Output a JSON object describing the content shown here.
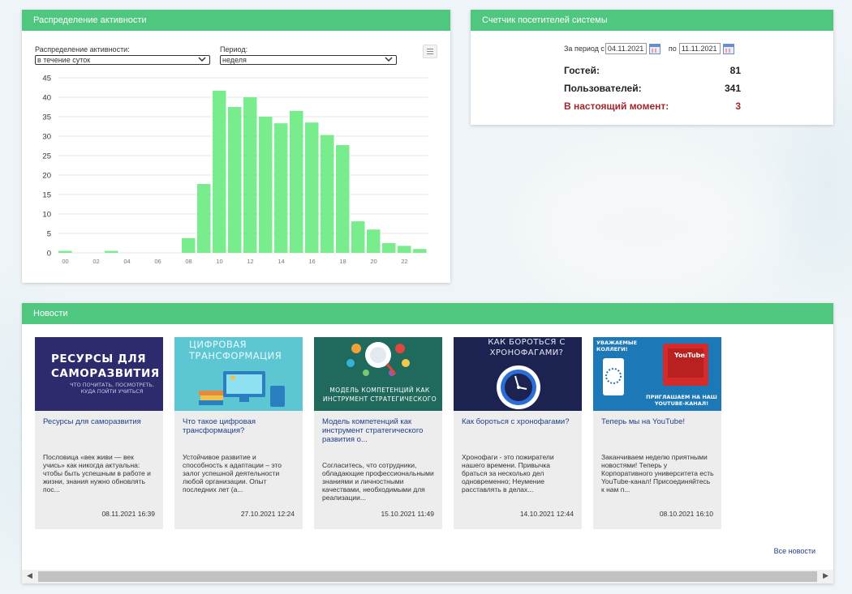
{
  "activity": {
    "title": "Распределение активности",
    "distribution_label": "Распределение активности:",
    "distribution_value": "в течение суток",
    "period_label": "Период:",
    "period_value": "неделя"
  },
  "chart_data": {
    "type": "bar",
    "title": "",
    "xlabel": "",
    "ylabel": "",
    "ylim": [
      0,
      45
    ],
    "y_ticks": [
      0,
      5,
      10,
      15,
      20,
      25,
      30,
      35,
      40,
      45
    ],
    "x_tick_labels": [
      "00",
      "02",
      "04",
      "06",
      "08",
      "10",
      "12",
      "14",
      "16",
      "18",
      "20",
      "22"
    ],
    "categories": [
      "00",
      "01",
      "02",
      "03",
      "04",
      "05",
      "06",
      "07",
      "08",
      "09",
      "10",
      "11",
      "12",
      "13",
      "14",
      "15",
      "16",
      "17",
      "18",
      "19",
      "20",
      "21",
      "22",
      "23"
    ],
    "values": [
      0.5,
      0,
      0,
      0.5,
      0,
      0,
      0,
      0,
      3.8,
      17.7,
      41.7,
      37.5,
      40,
      35,
      33.3,
      36.5,
      33.5,
      30.3,
      27.7,
      8.1,
      6,
      2.5,
      1.8,
      1
    ],
    "bar_color": "#79ec8d",
    "grid": true
  },
  "visitors": {
    "title": "Счетчик посетителей системы",
    "period_from_label": "За период с",
    "date_from": "04.11.2021",
    "period_to_label": "по",
    "date_to": "11.11.2021",
    "guests_label": "Гостей:",
    "guests_value": "81",
    "users_label": "Пользователей:",
    "users_value": "341",
    "now_label": "В настоящий момент:",
    "now_value": "3"
  },
  "news": {
    "title": "Новости",
    "all_news_label": "Все новости",
    "items": [
      {
        "title": "Ресурсы для саморазвития",
        "text": "Пословица «век живи — век учись» как никогда актуальна: чтобы быть успешным в работе и жизни, знания нужно обновлять пос...",
        "date": "08.11.2021 16:39",
        "image_title": "РЕСУРСЫ ДЛЯ САМОРАЗВИТИЯ",
        "image_subtitle": "ЧТО ПОЧИТАТЬ, ПОСМОТРЕТЬ, КУДА ПОЙТИ УЧИТЬСЯ"
      },
      {
        "title": "Что такое цифровая трансформация?",
        "text": "Устойчивое развитие и способность к адаптации – это залог успешной деятельности любой организации. Опыт последних лет (а...",
        "date": "27.10.2021 12:24",
        "image_title": "ЦИФРОВАЯ ТРАНСФОРМАЦИЯ"
      },
      {
        "title": "Модель компетенций как инструмент стратегического развития о...",
        "text": "Согласитесь, что сотрудники, обладающие профессиональными знаниями и личностными качествами, необходимыми для реализации...",
        "date": "15.10.2021 11:49",
        "image_title": "МОДЕЛЬ КОМПЕТЕНЦИЙ КАК ИНСТРУМЕНТ СТРАТЕГИЧЕСКОГО"
      },
      {
        "title": "Как бороться с хронофагами?",
        "text": "Хронофаги - это пожиратели нашего времени.   Привычка браться за несколько дел одновременно; Неумение расставлять в делах...",
        "date": "14.10.2021 12:44",
        "image_title": "КАК БОРОТЬСЯ С ХРОНОФАГАМИ?"
      },
      {
        "title": "Теперь мы на YouTube!",
        "text": "Заканчиваем неделю приятными новостями! Теперь у Корпоративного университета есть YouTube-канал! Присоединяйтесь к нам п...",
        "date": "08.10.2021 16:10",
        "image_title": "УВАЖАЕМЫЕ КОЛЛЕГИ!",
        "image_subtitle": "ПРИГЛАШАЕМ НА НАШ YOUTUBE-КАНАЛ!",
        "image_badge": "YouTube"
      }
    ]
  },
  "icons": {
    "calendar": "calendar-icon",
    "list": "list-icon",
    "dropdown": "chevron-down-icon",
    "scroll_left": "arrow-left-icon",
    "scroll_right": "arrow-right-icon"
  },
  "colors": {
    "header_green": "#4fc77f",
    "bar_green": "#79ec8d",
    "link_blue": "#1f3f8a",
    "now_red": "#a3262a"
  }
}
